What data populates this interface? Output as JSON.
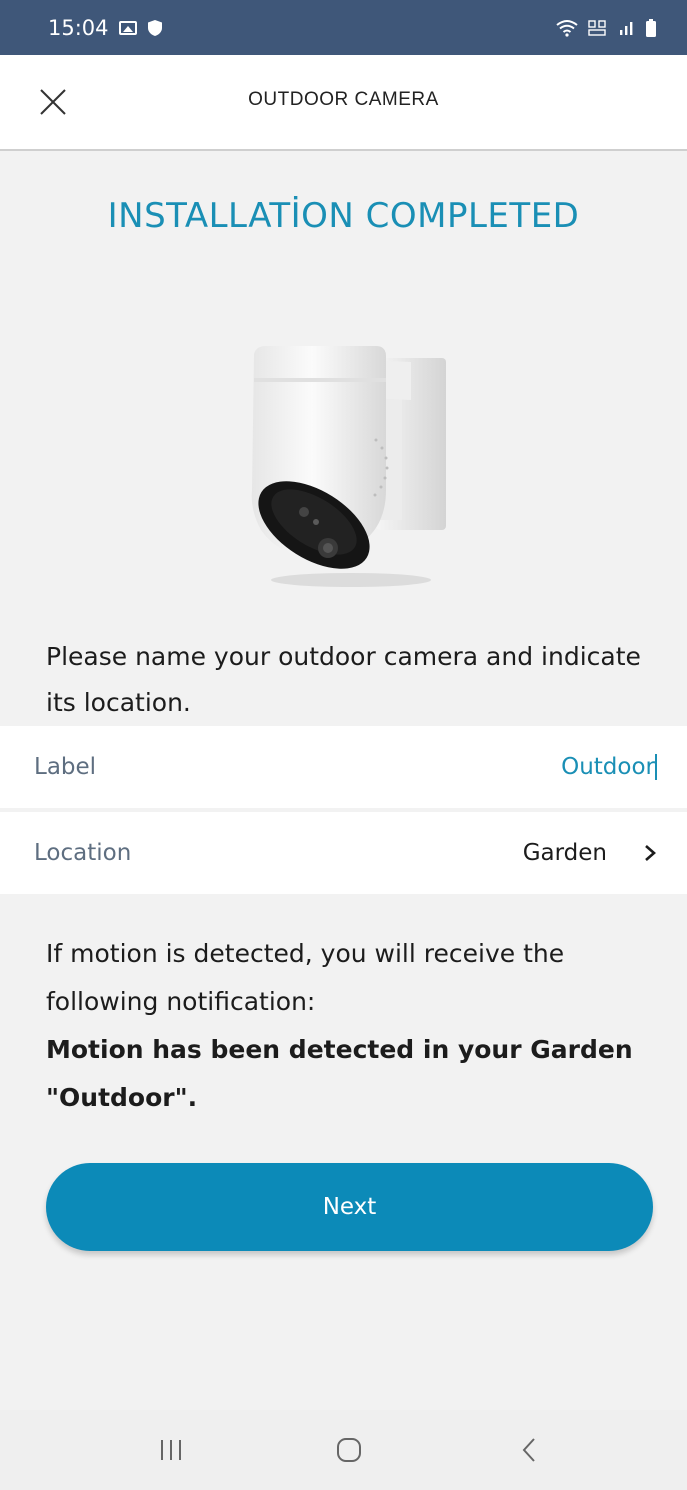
{
  "status_bar": {
    "time": "15:04"
  },
  "header": {
    "title": "OUTDOOR CAMERA"
  },
  "main": {
    "title": "INSTALLATİON COMPLETED",
    "intro": "Please name your outdoor camera and indicate its location.",
    "label_field": {
      "label": "Label",
      "value": "Outdoor"
    },
    "location_field": {
      "label": "Location",
      "value": "Garden"
    },
    "notice_text": "If motion is detected, you will receive the following notification:",
    "notice_bold": "Motion has been detected in your Garden \"Outdoor\".",
    "next_label": "Next"
  },
  "colors": {
    "accent": "#1a8fb5",
    "button": "#0c8ab8",
    "status_bar": "#3f5779"
  }
}
